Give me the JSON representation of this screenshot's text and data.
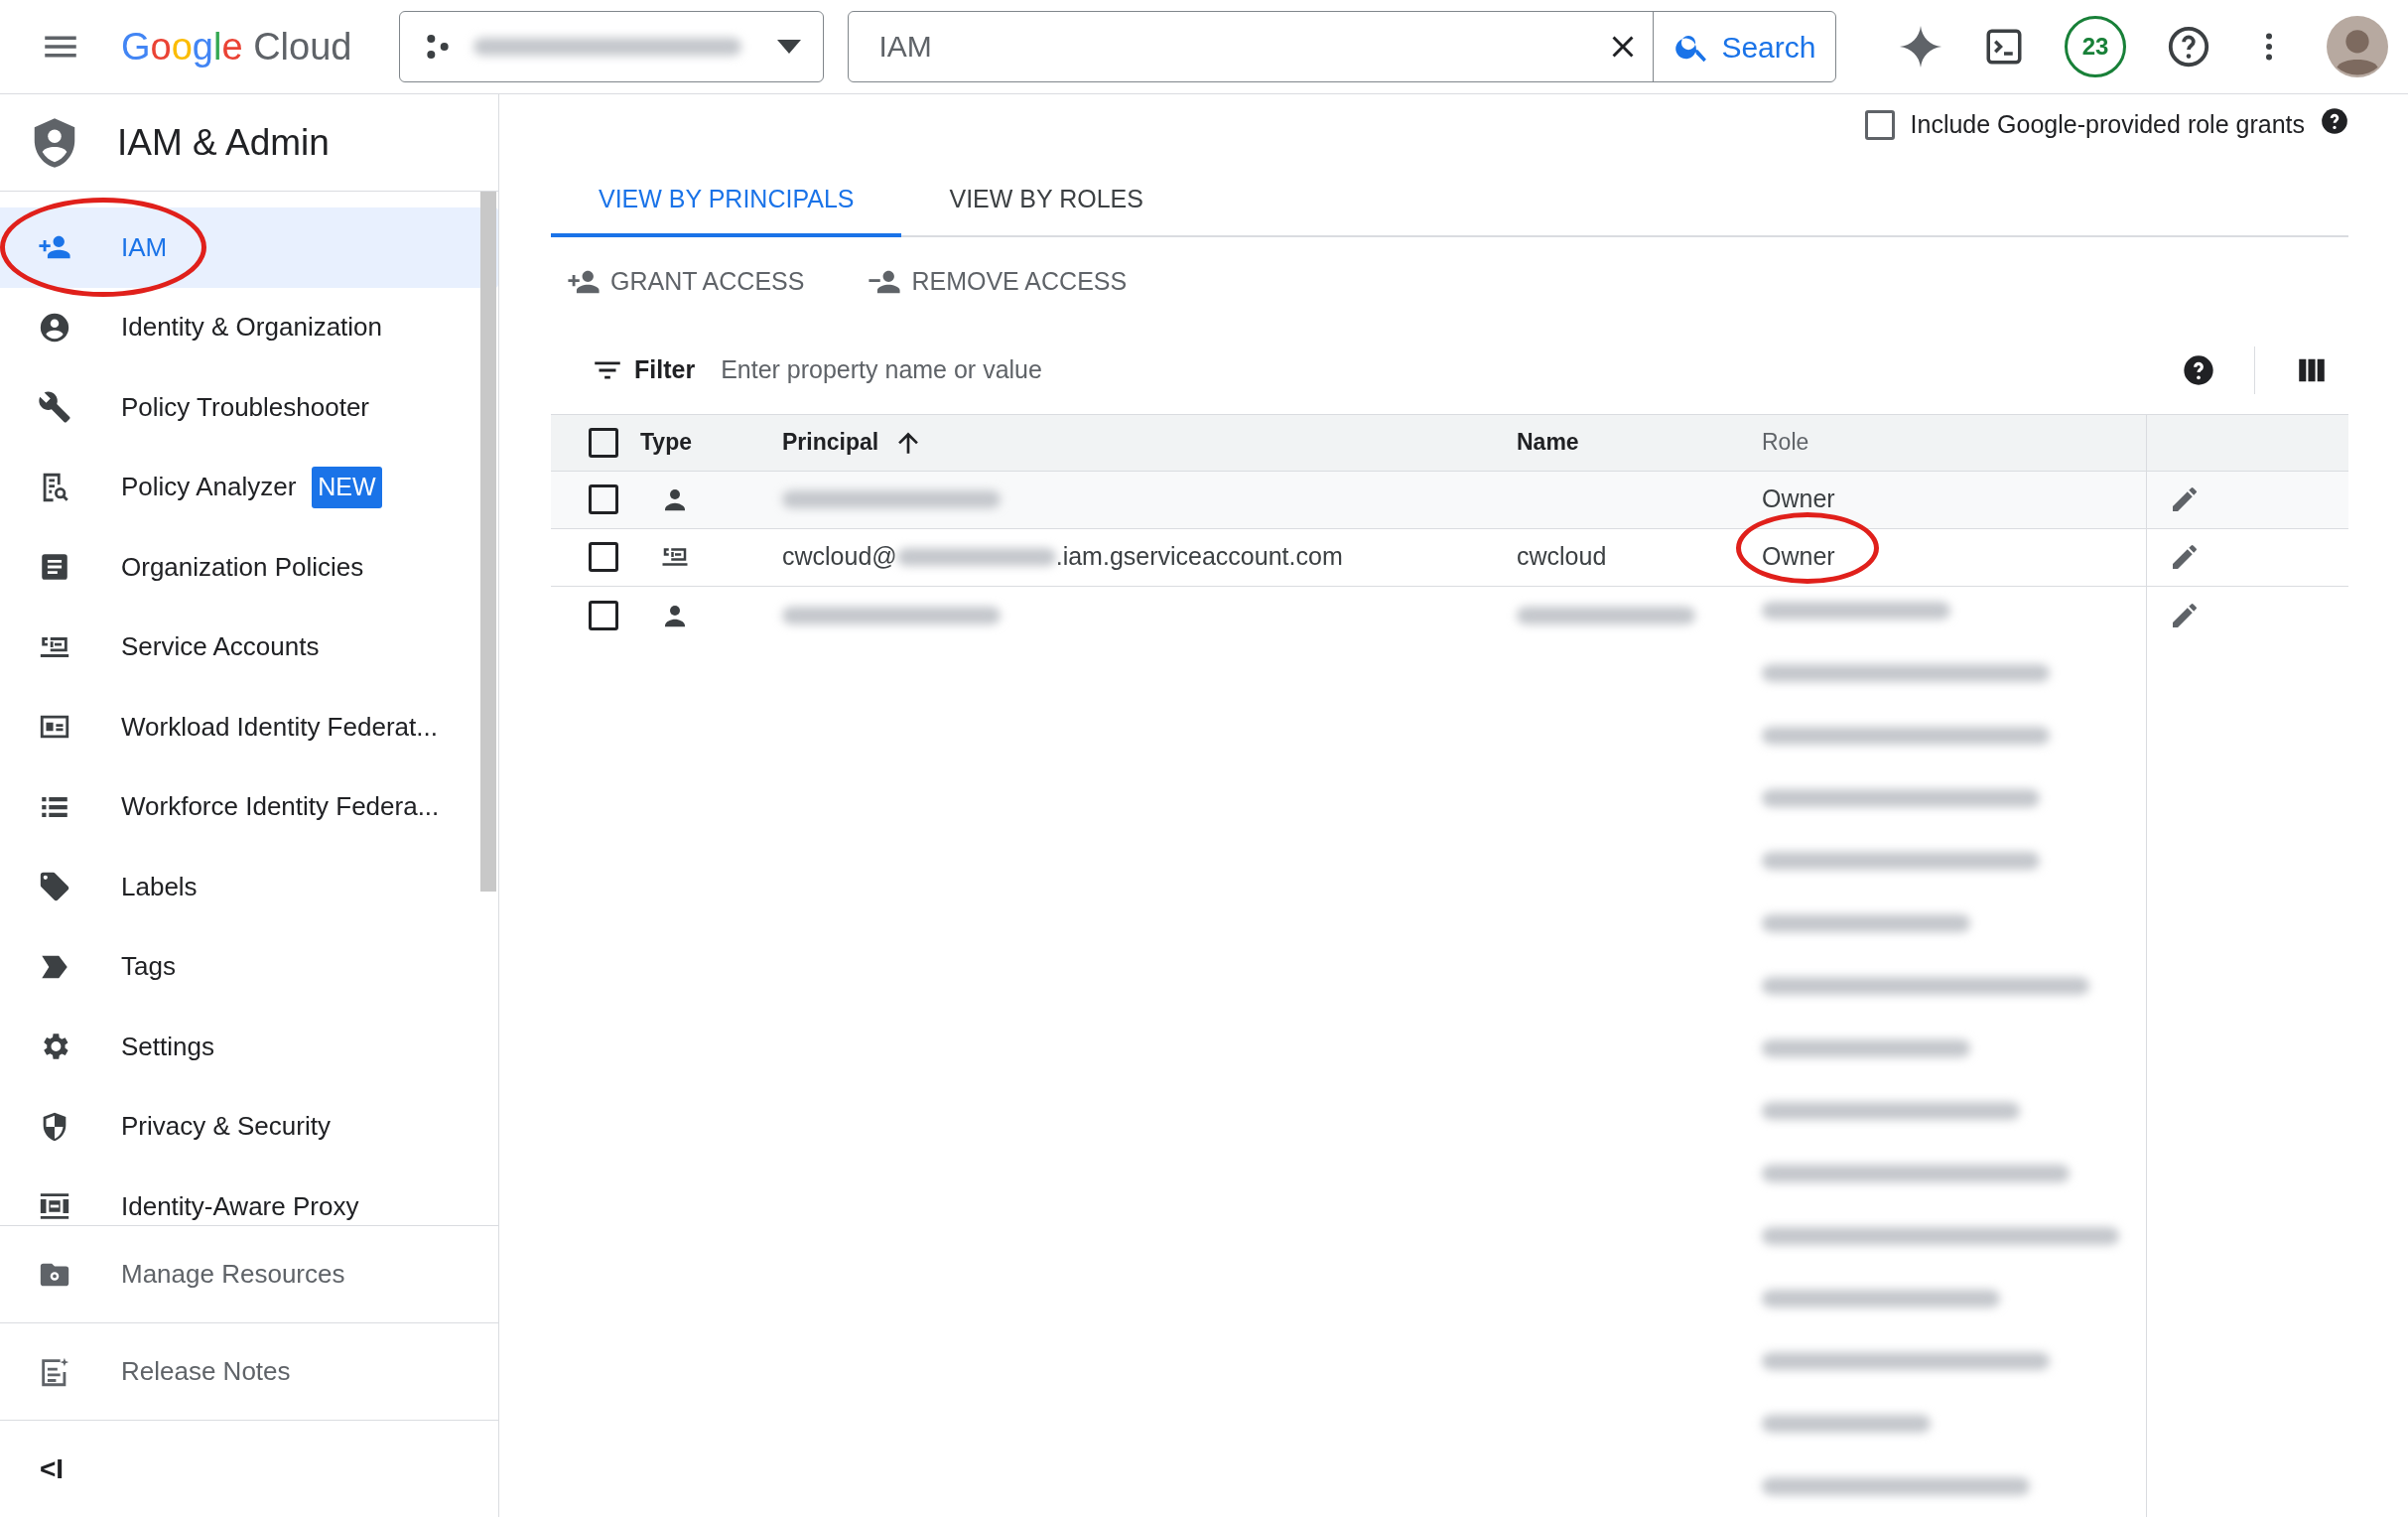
{
  "header": {
    "logo": "Google Cloud",
    "search": {
      "value": "IAM",
      "button": "Search"
    },
    "notifications": "23"
  },
  "sidebar": {
    "title": "IAM & Admin",
    "items": [
      {
        "label": "IAM",
        "selected": true,
        "highlighted": true
      },
      {
        "label": "Identity & Organization",
        "selected": false,
        "highlighted": false
      },
      {
        "label": "Policy Troubleshooter",
        "selected": false,
        "highlighted": false
      },
      {
        "label": "Policy Analyzer",
        "selected": false,
        "highlighted": false,
        "badge": "NEW"
      },
      {
        "label": "Organization Policies",
        "selected": false,
        "highlighted": false
      },
      {
        "label": "Service Accounts",
        "selected": false,
        "highlighted": false
      },
      {
        "label": "Workload Identity Federat...",
        "selected": false,
        "highlighted": false
      },
      {
        "label": "Workforce Identity Federa...",
        "selected": false,
        "highlighted": false
      },
      {
        "label": "Labels",
        "selected": false,
        "highlighted": false
      },
      {
        "label": "Tags",
        "selected": false,
        "highlighted": false
      },
      {
        "label": "Settings",
        "selected": false,
        "highlighted": false
      },
      {
        "label": "Privacy & Security",
        "selected": false,
        "highlighted": false
      },
      {
        "label": "Identity-Aware Proxy",
        "selected": false,
        "highlighted": false
      }
    ],
    "footer_items": [
      {
        "label": "Manage Resources"
      },
      {
        "label": "Release Notes"
      }
    ],
    "collapse": "<I"
  },
  "main": {
    "include_grants": {
      "label": "Include Google-provided role grants",
      "checked": false
    },
    "tabs": [
      {
        "label": "VIEW BY PRINCIPALS",
        "selected": true
      },
      {
        "label": "VIEW BY ROLES",
        "selected": false
      }
    ],
    "actions": [
      "GRANT ACCESS",
      "REMOVE ACCESS"
    ],
    "filter": {
      "label": "Filter",
      "placeholder": "Enter property name or value"
    },
    "table": {
      "select_all_checked": false,
      "columns": [
        "Type",
        "Principal",
        "Name",
        "Role"
      ],
      "rows": [
        {
          "kind": "person",
          "checked": false,
          "principal_prefix": "",
          "principal_redacted": true,
          "principal_suffix": "",
          "name": "",
          "name_redacted": false,
          "role": "Owner",
          "role_highlighted": false,
          "roles_redacted": false
        },
        {
          "kind": "service",
          "checked": false,
          "principal_prefix": "cwcloud@",
          "principal_redacted": true,
          "principal_suffix": ".iam.gserviceaccount.com",
          "name": "cwcloud",
          "name_redacted": false,
          "role": "Owner",
          "role_highlighted": true,
          "roles_redacted": false
        },
        {
          "kind": "person",
          "checked": false,
          "principal_prefix": "",
          "principal_redacted": true,
          "principal_suffix": "",
          "name": "",
          "name_redacted": true,
          "role": "",
          "role_highlighted": false,
          "roles_redacted": true
        }
      ]
    }
  }
}
